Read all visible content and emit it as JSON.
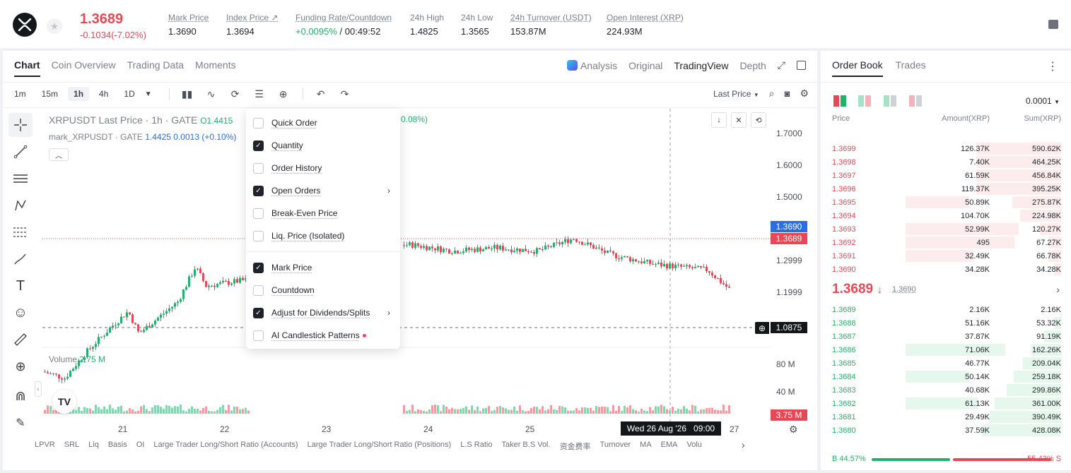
{
  "header": {
    "last_price": "1.3689",
    "change": "-0.1034(-7.02%)",
    "stats": [
      {
        "label": "Mark Price",
        "value": "1.3690"
      },
      {
        "label": "Index Price ↗",
        "value": "1.3694"
      },
      {
        "label": "Funding Rate/Countdown",
        "value_green": "+0.0095%",
        "value": " / 00:49:52"
      },
      {
        "label": "24h High",
        "value": "1.4825"
      },
      {
        "label": "24h Low",
        "value": "1.3565"
      },
      {
        "label": "24h Turnover (USDT)",
        "value": "153.87M"
      },
      {
        "label": "Open Interest (XRP)",
        "value": "224.93M"
      }
    ]
  },
  "chart_tabs": [
    "Chart",
    "Coin Overview",
    "Trading Data",
    "Moments"
  ],
  "view_tabs": {
    "analysis": "Analysis",
    "original": "Original",
    "tradingview": "TradingView",
    "depth": "Depth"
  },
  "timeframes": [
    "1m",
    "15m",
    "1h",
    "4h",
    "1D"
  ],
  "price_type": "Last Price",
  "legend": {
    "symbol": "XRPUSDT Last Price · 1h · GATE",
    "open": "O1.4415",
    "pct": "0.08%)",
    "mark_name": "mark_XRPUSDT · GATE",
    "mark_vals": "1.4425  0.0013 (+0.10%)"
  },
  "y_axis": [
    "1.7000",
    "1.6000",
    "1.5000",
    "1.2999",
    "1.1999"
  ],
  "price_tags": {
    "mark": "1.3690",
    "last": "1.3689",
    "cursor": "1.0875"
  },
  "volume": {
    "label": "Volume",
    "value": "2.75 M",
    "axis": [
      "80 M",
      "40 M"
    ],
    "tag": "3.75 M"
  },
  "x_axis": [
    "21",
    "22",
    "23",
    "24",
    "25",
    "27"
  ],
  "crosshair_date": {
    "date": "Wed 26 Aug '26",
    "time": "09:00"
  },
  "indicators": [
    "LPVR",
    "SRL",
    "Liq",
    "Basis",
    "OI",
    "Large Trader Long/Short Ratio (Accounts)",
    "Large Trader Long/Short Ratio (Positions)",
    "L.S Ratio",
    "Taker B.S Vol.",
    "资金费率",
    "Turnover",
    "MA",
    "EMA",
    "Volu"
  ],
  "dropdown": [
    {
      "label": "Quick Order",
      "checked": false
    },
    {
      "label": "Quantity",
      "checked": true
    },
    {
      "label": "Order History",
      "checked": false
    },
    {
      "label": "Open Orders",
      "checked": true,
      "submenu": true
    },
    {
      "label": "Break-Even Price",
      "checked": false
    },
    {
      "label": "Liq. Price (Isolated)",
      "checked": false
    },
    {
      "label": "Mark Price",
      "checked": true
    },
    {
      "label": "Countdown",
      "checked": false
    },
    {
      "label": "Adjust for Dividends/Splits",
      "checked": true,
      "submenu": true
    },
    {
      "label": "AI Candlestick Patterns",
      "checked": false,
      "new_dot": true
    }
  ],
  "order_book": {
    "tabs": [
      "Order Book",
      "Trades"
    ],
    "precision": "0.0001",
    "headers": {
      "price": "Price",
      "amount": "Amount(XRP)",
      "sum": "Sum(XRP)"
    },
    "asks": [
      {
        "price": "1.3699",
        "amount": "126.37K",
        "sum": "590.62K",
        "depth": 0.75,
        "amt": 0.0
      },
      {
        "price": "1.3698",
        "amount": "7.40K",
        "sum": "464.25K",
        "depth": 0.75,
        "amt": 0.0
      },
      {
        "price": "1.3697",
        "amount": "61.59K",
        "sum": "456.84K",
        "depth": 0.75,
        "amt": 0.0
      },
      {
        "price": "1.3696",
        "amount": "119.37K",
        "sum": "395.25K",
        "depth": 0.75,
        "amt": 0.0
      },
      {
        "price": "1.3695",
        "amount": "50.89K",
        "sum": "275.87K",
        "depth": 0.43,
        "amt": 0.86
      },
      {
        "price": "1.3694",
        "amount": "104.70K",
        "sum": "224.98K",
        "depth": 0.36,
        "amt": 0.0
      },
      {
        "price": "1.3693",
        "amount": "52.99K",
        "sum": "120.27K",
        "depth": 0.19,
        "amt": 0.75
      },
      {
        "price": "1.3692",
        "amount": "495",
        "sum": "67.27K",
        "depth": 0.11,
        "amt": 0.76
      },
      {
        "price": "1.3691",
        "amount": "32.49K",
        "sum": "66.78K",
        "depth": 0.11,
        "amt": 0.85
      },
      {
        "price": "1.3690",
        "amount": "34.28K",
        "sum": "34.28K",
        "depth": 0.06,
        "amt": 0.0
      }
    ],
    "mid_price": "1.3689",
    "mid_mark": "1.3690",
    "bids": [
      {
        "price": "1.3689",
        "amount": "2.16K",
        "sum": "2.16K",
        "depth": 0.0,
        "amt": 0.0
      },
      {
        "price": "1.3688",
        "amount": "51.16K",
        "sum": "53.32K",
        "depth": 0.06,
        "amt": 0.0
      },
      {
        "price": "1.3687",
        "amount": "37.87K",
        "sum": "91.19K",
        "depth": 0.15,
        "amt": 0.0
      },
      {
        "price": "1.3686",
        "amount": "71.06K",
        "sum": "162.26K",
        "depth": 0.26,
        "amt": 0.78
      },
      {
        "price": "1.3685",
        "amount": "46.77K",
        "sum": "209.04K",
        "depth": 0.34,
        "amt": 0.0
      },
      {
        "price": "1.3684",
        "amount": "50.14K",
        "sum": "259.18K",
        "depth": 0.42,
        "amt": 0.86
      },
      {
        "price": "1.3683",
        "amount": "40.68K",
        "sum": "299.86K",
        "depth": 0.48,
        "amt": 0.0
      },
      {
        "price": "1.3682",
        "amount": "61.13K",
        "sum": "361.00K",
        "depth": 0.59,
        "amt": 0.84
      },
      {
        "price": "1.3681",
        "amount": "29.49K",
        "sum": "390.49K",
        "depth": 0.63,
        "amt": 0.0
      },
      {
        "price": "1.3680",
        "amount": "37.59K",
        "sum": "428.08K",
        "depth": 0.7,
        "amt": 0.0
      }
    ],
    "buy_ratio": "B 44.57%",
    "sell_ratio": "55.43% S",
    "buy_fraction": 0.4457
  },
  "colors": {
    "up": "#20b26c",
    "down": "#e84855",
    "accent": "#1f2329"
  }
}
